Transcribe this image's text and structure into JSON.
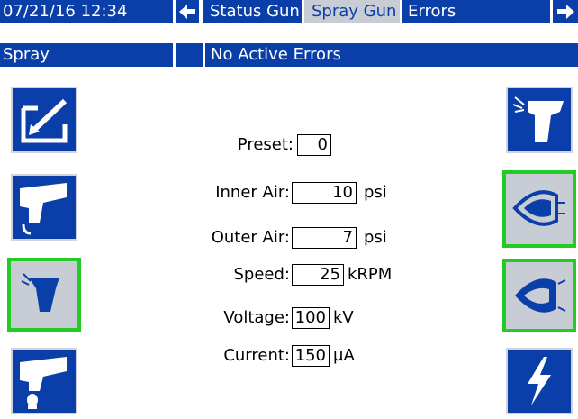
{
  "header": {
    "datetime": "07/21/16 12:34",
    "tabs": [
      {
        "label": "Status Gun",
        "selected": false
      },
      {
        "label": "Spray Gun",
        "selected": true
      },
      {
        "label": "Errors",
        "selected": false
      }
    ],
    "mode": "Spray",
    "status": "No Active Errors"
  },
  "fields": [
    {
      "label": "Preset:",
      "value": "0",
      "unit": ""
    },
    {
      "label": "Inner Air:",
      "value": "10",
      "unit": "psi"
    },
    {
      "label": "Outer Air:",
      "value": "7",
      "unit": "psi"
    },
    {
      "label": "Speed:",
      "value": "25",
      "unit": "kRPM"
    },
    {
      "label": "Voltage:",
      "value": "100",
      "unit": "kV"
    },
    {
      "label": "Current:",
      "value": "150",
      "unit": "µA"
    }
  ],
  "colors": {
    "header_bg": "#0a3ea8",
    "selected_tab_bg": "#c8ccd4",
    "active_border": "#22cc22"
  }
}
